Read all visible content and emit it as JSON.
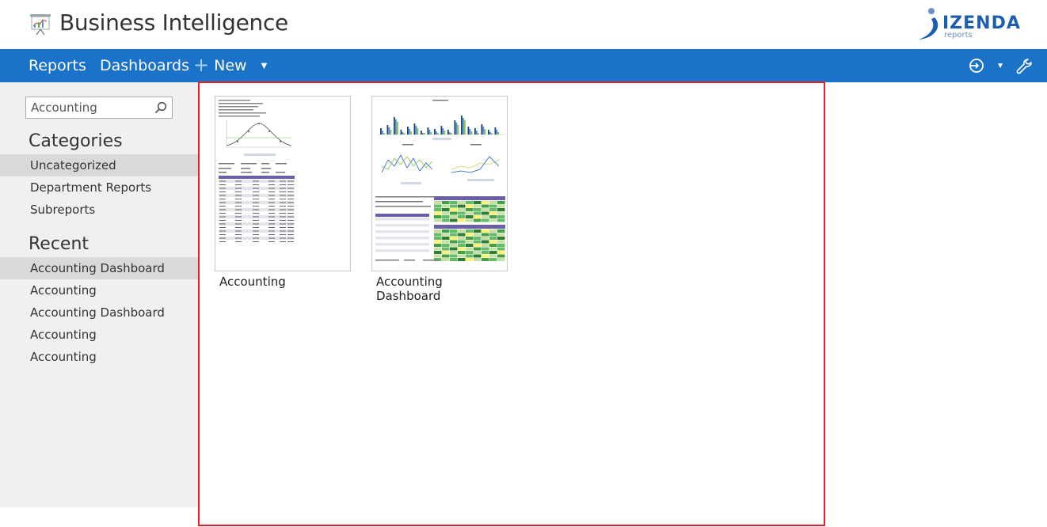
{
  "header": {
    "app_title": "Business Intelligence",
    "logo_text": "IZENDA",
    "logo_sub": "reports"
  },
  "nav": {
    "reports": "Reports",
    "dashboards": "Dashboards",
    "new_label": "New"
  },
  "sidebar": {
    "search_value": "Accounting",
    "categories_title": "Categories",
    "categories": [
      {
        "label": "Uncategorized",
        "active": true
      },
      {
        "label": "Department Reports",
        "active": false
      },
      {
        "label": "Subreports",
        "active": false
      }
    ],
    "recent_title": "Recent",
    "recent": [
      {
        "label": "Accounting Dashboard",
        "active": true
      },
      {
        "label": "Accounting",
        "active": false
      },
      {
        "label": "Accounting Dashboard",
        "active": false
      },
      {
        "label": "Accounting",
        "active": false
      },
      {
        "label": "Accounting",
        "active": false
      }
    ]
  },
  "tiles": [
    {
      "label": "Accounting",
      "kind": "report"
    },
    {
      "label": "Accounting Dashboard",
      "kind": "dashboard"
    }
  ],
  "colors": {
    "nav_bg": "#1a72c9",
    "sidebar_bg": "#f0f0f0",
    "selection_border": "#e0202a",
    "logo_blue": "#1c5fb0"
  }
}
